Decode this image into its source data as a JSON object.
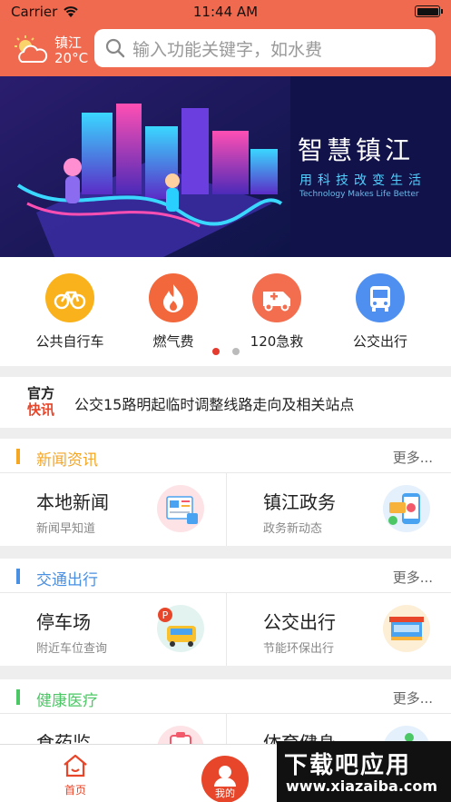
{
  "status_bar": {
    "carrier": "Carrier",
    "time": "11:44 AM"
  },
  "weather": {
    "city": "镇江",
    "temperature": "20°C",
    "icon": "partly-cloudy-icon"
  },
  "search": {
    "placeholder": "输入功能关键字，如水费"
  },
  "banner": {
    "title": "智慧镇江",
    "subtitle": "用科技改变生活",
    "tagline": "Technology Makes Life Better"
  },
  "shortcuts": [
    {
      "label": "公共自行车",
      "icon": "bicycle-icon",
      "color": "#f9b21b"
    },
    {
      "label": "燃气费",
      "icon": "flame-icon",
      "color": "#f2683c"
    },
    {
      "label": "120急救",
      "icon": "ambulance-icon",
      "color": "#f36d4f"
    },
    {
      "label": "公交出行",
      "icon": "bus-icon",
      "color": "#4f8ff0"
    }
  ],
  "pager": {
    "active_index": 0,
    "count": 2
  },
  "notice": {
    "logo_top": "官方",
    "logo_bottom": "快讯",
    "text": "公交15路明起临时调整线路走向及相关站点"
  },
  "sections": [
    {
      "title": "新闻资讯",
      "color": "#f5a623",
      "more": "更多...",
      "items": [
        {
          "title": "本地新闻",
          "subtitle": "新闻早知道",
          "icon": "newspaper-icon"
        },
        {
          "title": "镇江政务",
          "subtitle": "政务新动态",
          "icon": "gov-phone-icon"
        }
      ]
    },
    {
      "title": "交通出行",
      "color": "#4a90e2",
      "more": "更多...",
      "items": [
        {
          "title": "停车场",
          "subtitle": "附近车位查询",
          "icon": "parking-icon"
        },
        {
          "title": "公交出行",
          "subtitle": "节能环保出行",
          "icon": "bus-stop-icon"
        }
      ]
    },
    {
      "title": "健康医疗",
      "color": "#4cc765",
      "more": "更多...",
      "items": [
        {
          "title": "食药监",
          "subtitle": "",
          "icon": "medicine-icon"
        },
        {
          "title": "体育健身",
          "subtitle": "",
          "icon": "fitness-icon"
        }
      ]
    }
  ],
  "tabbar": {
    "home": "首页",
    "mine": "我的",
    "accent": "#e8462a"
  },
  "watermark": {
    "line1": "下载吧应用",
    "line2": "www.xiazaiba.com"
  }
}
